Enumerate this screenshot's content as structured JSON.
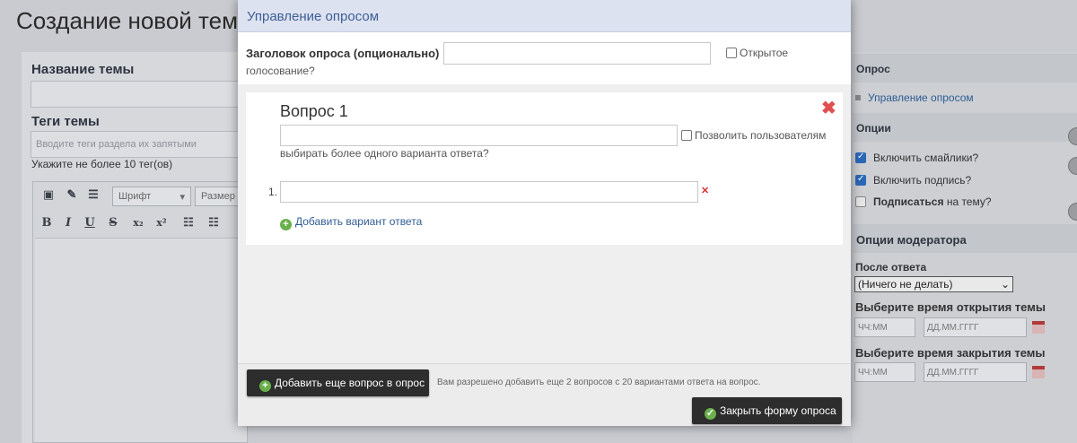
{
  "background": {
    "page_title": "Создание новой темы",
    "topic_name_label": "Название темы",
    "tags_label": "Теги темы",
    "tags_placeholder": "Вводите теги раздела их запятыми",
    "tags_hint": "Укажите не более 10 тег(ов)",
    "editor": {
      "font_select": "Шрифт",
      "size_select": "Размер",
      "bold": "B",
      "italic": "I",
      "underline": "U",
      "strike": "S",
      "subscript": "x₂",
      "superscript": "x²"
    },
    "sidebar": {
      "poll_header": "Опрос",
      "poll_manage_link": "Управление опросом",
      "options_header": "Опции",
      "enable_smileys": "Включить смайлики?",
      "enable_signature": "Включить подпись?",
      "subscribe_bold": "Подписаться",
      "subscribe_rest": "на тему?",
      "moderator_header": "Опции модератора",
      "after_reply_label": "После ответа",
      "after_reply_value": "(Ничего не делать)",
      "open_time_label": "Выберите время открытия темы",
      "close_time_label": "Выберите время закрытия темы",
      "time_placeholder": "ЧЧ:ММ",
      "date_placeholder": "ДД.ММ.ГГГГ"
    }
  },
  "modal": {
    "title": "Управление опросом",
    "poll_title_label": "Заголовок опроса (опционально)",
    "poll_title_value": "",
    "open_vote_line1": "Открытое",
    "open_vote_line2": "голосование?",
    "question": {
      "title": "Вопрос 1",
      "value": "",
      "multi_line1": "Позволить пользователям",
      "multi_line2": "выбирать более одного варианта ответа?",
      "answers": [
        {
          "number": "1.",
          "value": ""
        }
      ],
      "add_answer": "Добавить вариант ответа"
    },
    "add_question_button": "Добавить еще вопрос в опрос",
    "limit_note": "Вам разрешено добавить еще 2 вопросов с 20 вариантами ответа на вопрос.",
    "close_button": "Закрыть форму опроса"
  }
}
